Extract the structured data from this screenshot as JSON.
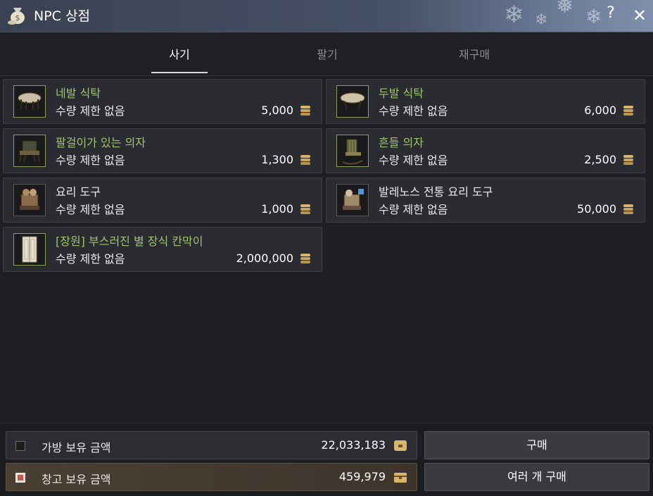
{
  "window": {
    "title": "NPC 상점"
  },
  "tabs": [
    {
      "label": "사기",
      "active": true
    },
    {
      "label": "팔기",
      "active": false
    },
    {
      "label": "재구매",
      "active": false
    }
  ],
  "items": [
    {
      "name": "네발 식탁",
      "limit": "수량 제한 없음",
      "price": "5,000",
      "name_color": "#9ec46c",
      "icon": "four-leg-table-icon"
    },
    {
      "name": "두발 식탁",
      "limit": "수량 제한 없음",
      "price": "6,000",
      "name_color": "#9ec46c",
      "icon": "two-leg-table-icon"
    },
    {
      "name": "팔걸이가 있는 의자",
      "limit": "수량 제한 없음",
      "price": "1,300",
      "name_color": "#9ec46c",
      "icon": "armchair-icon"
    },
    {
      "name": "흔들 의자",
      "limit": "수량 제한 없음",
      "price": "2,500",
      "name_color": "#9ec46c",
      "icon": "rocking-chair-icon"
    },
    {
      "name": "요리 도구",
      "limit": "수량 제한 없음",
      "price": "1,000",
      "name_color": "#e8e8e8",
      "icon": "cooking-utensil-icon"
    },
    {
      "name": "발레노스 전통 요리 도구",
      "limit": "수량 제한 없음",
      "price": "50,000",
      "name_color": "#e8e8e8",
      "icon": "velia-cooking-utensil-icon"
    },
    {
      "name": "[장원] 부스러진 별 장식 칸막이",
      "limit": "수량 제한 없음",
      "price": "2,000,000",
      "name_color": "#9ec46c",
      "icon": "partition-icon"
    }
  ],
  "wallet": {
    "inventory": {
      "label": "가방 보유 금액",
      "value": "22,033,183",
      "checked": false
    },
    "storage": {
      "label": "창고 보유 금액",
      "value": "459,979",
      "checked": true
    }
  },
  "buttons": {
    "buy": "구매",
    "buy_multiple": "여러 개 구매"
  },
  "colors": {
    "item_name_green": "#9ec46c",
    "accent_gold": "#d9b56a",
    "titlebar": "#465066"
  }
}
